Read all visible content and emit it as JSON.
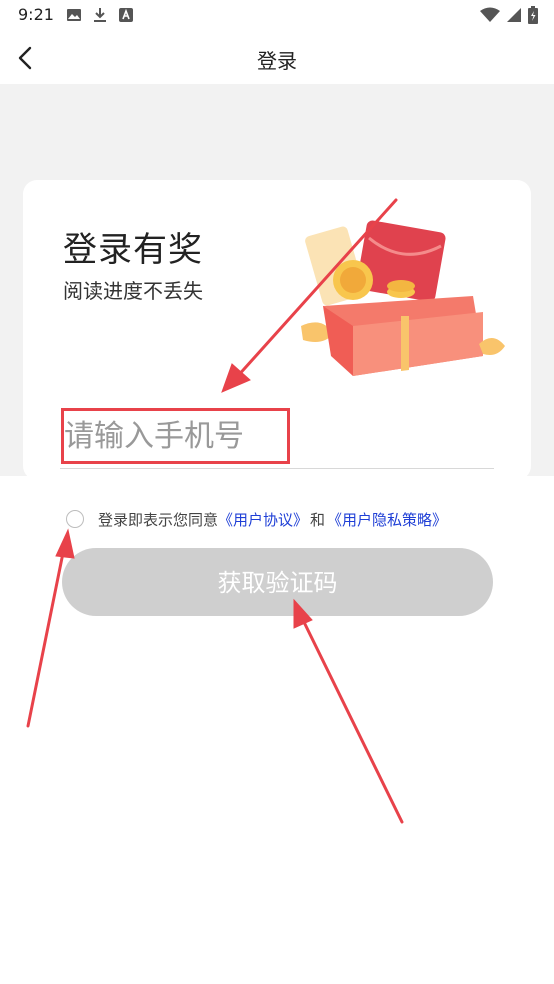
{
  "status_bar": {
    "time": "9:21",
    "icons": [
      "image-icon",
      "download-icon",
      "a-icon",
      "wifi-icon",
      "signal-icon",
      "battery-icon"
    ]
  },
  "nav": {
    "title": "登录",
    "back_icon": "chevron-left-icon"
  },
  "promo": {
    "title": "登录有奖",
    "subtitle": "阅读进度不丢失",
    "illustration": "gift-box-illustration"
  },
  "login_form": {
    "phone_placeholder": "请输入手机号",
    "phone_value": "",
    "agreement_prefix": "登录即表示您同意",
    "user_agreement_link": "《用户协议》",
    "agreement_and": "和",
    "privacy_policy_link": "《用户隐私策略》",
    "agreement_checked": false,
    "get_code_button": "获取验证码"
  },
  "colors": {
    "annotation_red": "#e8424a",
    "link_blue": "#1f3fd6",
    "button_disabled": "#cfcfcf",
    "page_grey": "#f2f2f2"
  }
}
